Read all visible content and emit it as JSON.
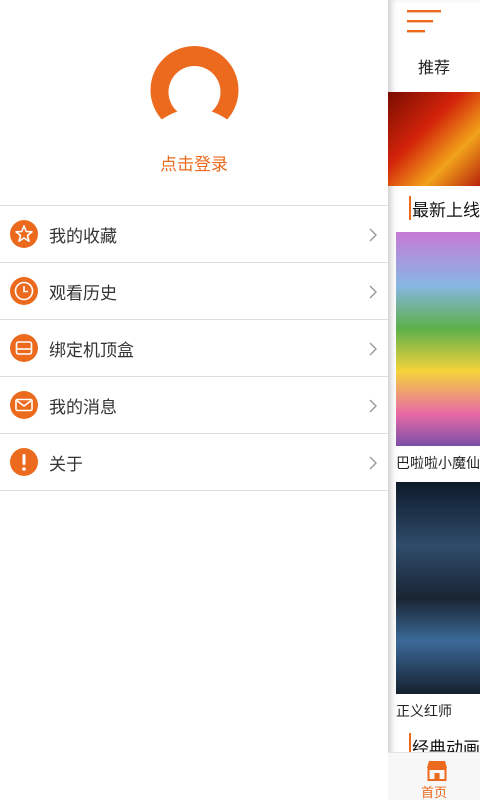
{
  "drawer": {
    "login_text": "点击登录",
    "menu_items": [
      {
        "label": "我的收藏",
        "icon": "star-icon"
      },
      {
        "label": "观看历史",
        "icon": "clock-icon"
      },
      {
        "label": "绑定机顶盒",
        "icon": "set-top-box-icon"
      },
      {
        "label": "我的消息",
        "icon": "mail-icon"
      },
      {
        "label": "关于",
        "icon": "info-icon"
      }
    ]
  },
  "main": {
    "tab_recommend": "推荐",
    "section_latest": "最新上线",
    "poster1_caption": "巴啦啦小魔仙",
    "poster2_caption": "正义红师",
    "section_classic": "经典动画",
    "bottom_nav": {
      "home_label": "首页"
    }
  },
  "colors": {
    "accent": "#ec6a1e",
    "divider": "#dddddd",
    "text": "#333333"
  }
}
